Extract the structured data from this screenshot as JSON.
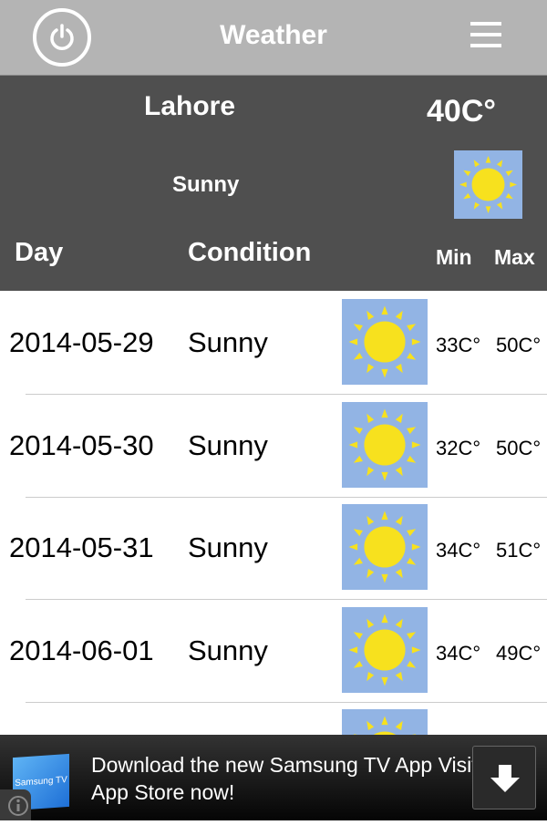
{
  "header": {
    "title": "Weather",
    "power_icon": "power-icon",
    "menu_icon": "hamburger-menu-icon"
  },
  "current": {
    "city": "Lahore",
    "temperature": "40C°",
    "condition": "Sunny",
    "icon": "sun-icon"
  },
  "columns": {
    "day": "Day",
    "condition": "Condition",
    "min": "Min",
    "max": "Max"
  },
  "forecast": [
    {
      "date": "2014-05-29",
      "condition": "Sunny",
      "min": "33C°",
      "max": "50C°"
    },
    {
      "date": "2014-05-30",
      "condition": "Sunny",
      "min": "32C°",
      "max": "50C°"
    },
    {
      "date": "2014-05-31",
      "condition": "Sunny",
      "min": "34C°",
      "max": "51C°"
    },
    {
      "date": "2014-06-01",
      "condition": "Sunny",
      "min": "34C°",
      "max": "49C°"
    }
  ],
  "ad": {
    "logo_text": "Samsung TV",
    "text": "Download the new Samsung TV App Visit the App Store now!",
    "download_icon": "download-arrow-icon",
    "info_icon": "info-icon"
  },
  "colors": {
    "header": "#b4b4b4",
    "panel": "#4f4f4f",
    "icon_bg": "#92b4e4",
    "sun": "#f7e11e"
  }
}
